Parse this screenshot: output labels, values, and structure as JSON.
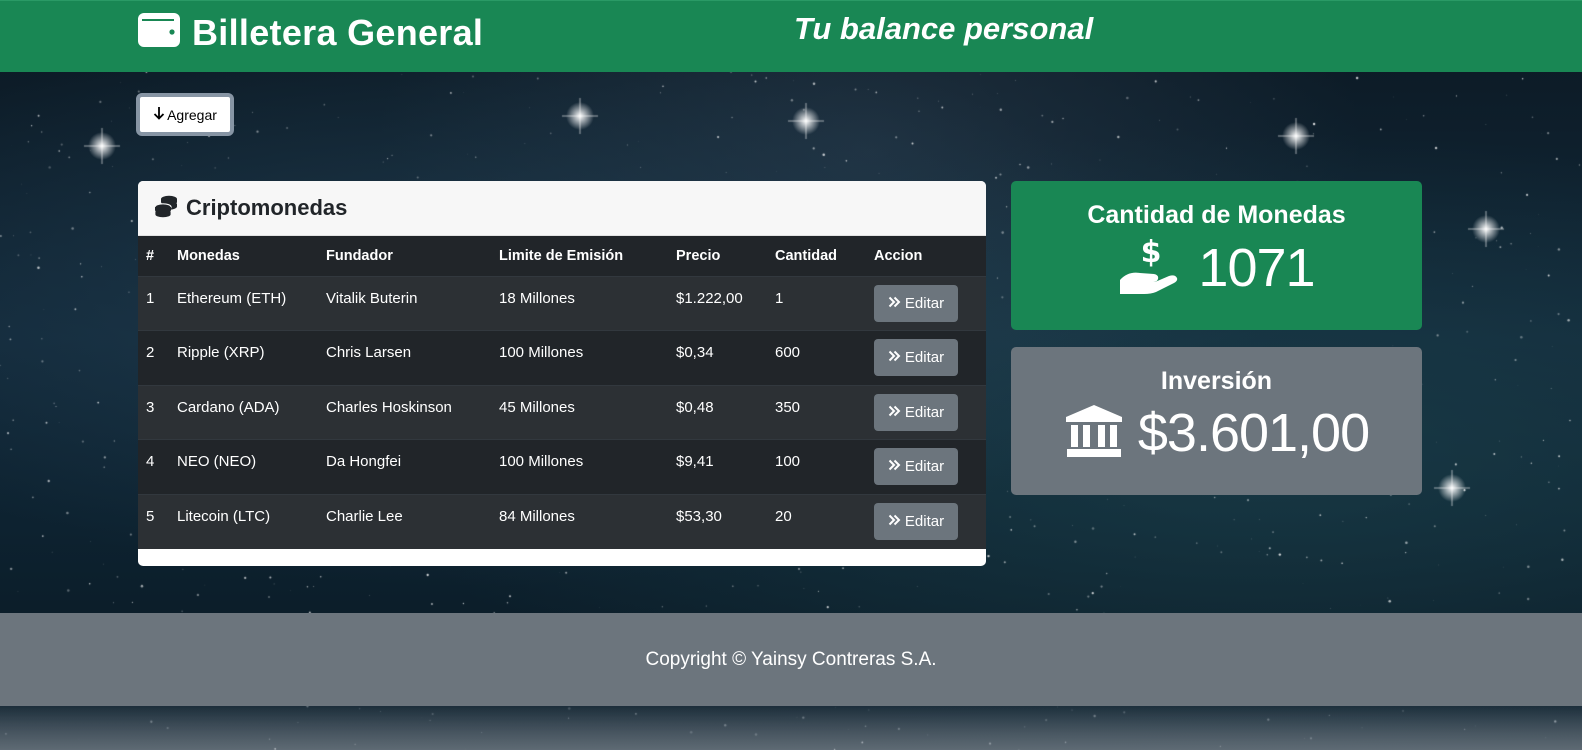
{
  "header": {
    "brand_title": "Billetera General",
    "tagline": "Tu balance personal",
    "brand_icon": "wallet-icon"
  },
  "toolbar": {
    "add_label": "Agregar",
    "add_icon": "arrow-down-icon"
  },
  "crypto_card": {
    "title": "Criptomonedas",
    "icon": "coins-icon",
    "columns": [
      "#",
      "Monedas",
      "Fundador",
      "Limite de Emisión",
      "Precio",
      "Cantidad",
      "Accion"
    ],
    "rows": [
      {
        "num": "1",
        "coin": "Ethereum (ETH)",
        "founder": "Vitalik Buterin",
        "limit": "18 Millones",
        "price": "$1.222,00",
        "qty": "1",
        "action": "Editar"
      },
      {
        "num": "2",
        "coin": "Ripple (XRP)",
        "founder": "Chris Larsen",
        "limit": "100 Millones",
        "price": "$0,34",
        "qty": "600",
        "action": "Editar"
      },
      {
        "num": "3",
        "coin": "Cardano (ADA)",
        "founder": "Charles Hoskinson",
        "limit": "45 Millones",
        "price": "$0,48",
        "qty": "350",
        "action": "Editar"
      },
      {
        "num": "4",
        "coin": "NEO (NEO)",
        "founder": "Da Hongfei",
        "limit": "100 Millones",
        "price": "$9,41",
        "qty": "100",
        "action": "Editar"
      },
      {
        "num": "5",
        "coin": "Litecoin (LTC)",
        "founder": "Charlie Lee",
        "limit": "84 Millones",
        "price": "$53,30",
        "qty": "20",
        "action": "Editar"
      }
    ]
  },
  "stats": {
    "coins": {
      "title": "Cantidad de Monedas",
      "value": "1071",
      "icon": "hand-holding-dollar-icon",
      "color": "#198754"
    },
    "investment": {
      "title": "Inversión",
      "value": "$3.601,00",
      "icon": "bank-icon",
      "color": "#6c757d"
    }
  },
  "footer": {
    "copyright": "Copyright © Yainsy Contreras S.A."
  },
  "colors": {
    "primary_green": "#198754",
    "secondary_gray": "#6c757d",
    "table_dark": "#212529"
  }
}
